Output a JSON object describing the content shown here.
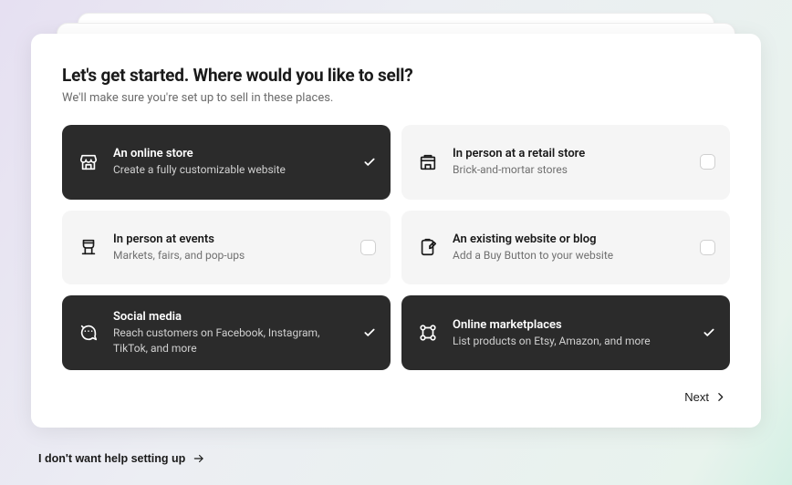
{
  "heading": "Let's get started. Where would you like to sell?",
  "subheading": "We'll make sure you're set up to sell in these places.",
  "options": [
    {
      "id": "online-store",
      "title": "An online store",
      "desc": "Create a fully customizable website",
      "selected": true,
      "icon": "store"
    },
    {
      "id": "retail-store",
      "title": "In person at a retail store",
      "desc": "Brick-and-mortar stores",
      "selected": false,
      "icon": "building"
    },
    {
      "id": "events",
      "title": "In person at events",
      "desc": "Markets, fairs, and pop-ups",
      "selected": false,
      "icon": "stall"
    },
    {
      "id": "existing-site",
      "title": "An existing website or blog",
      "desc": "Add a Buy Button to your website",
      "selected": false,
      "icon": "clipboard"
    },
    {
      "id": "social",
      "title": "Social media",
      "desc": "Reach customers on Facebook, Instagram, TikTok, and more",
      "selected": true,
      "icon": "chat"
    },
    {
      "id": "marketplaces",
      "title": "Online marketplaces",
      "desc": "List products on Etsy, Amazon, and more",
      "selected": true,
      "icon": "nodes"
    }
  ],
  "next_label": "Next",
  "skip_label": "I don't want help setting up"
}
